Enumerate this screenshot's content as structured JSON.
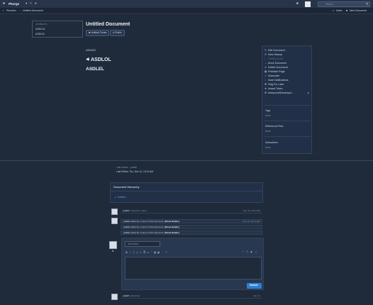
{
  "topbar": {
    "app_name": "Phorge",
    "notifications_count": "",
    "search_placeholder": "Search",
    "user_initial": ""
  },
  "crumbs": {
    "root": "Phriction",
    "current": "Untitled Document",
    "actions": [
      "Index",
      "New Document"
    ]
  },
  "toc": {
    "heading": "CONTENTS",
    "items": [
      "ASDLOL",
      "ASDLEL"
    ]
  },
  "header": {
    "title": "Untitled Document",
    "tags": [
      "Untitled Tortes",
      "Public"
    ]
  },
  "document": {
    "small_text": "ASDASD",
    "heading1": "ASDLOL",
    "heading2": "ASDLEL"
  },
  "actions": {
    "items": [
      {
        "label": "Edit Document",
        "icon": "pencil-icon",
        "enabled": true
      },
      {
        "label": "View History",
        "icon": "history-icon",
        "enabled": true
      },
      {
        "label": "Publish Draft",
        "icon": "upload-icon",
        "enabled": false
      },
      {
        "label": "Move Document",
        "icon": "arrows-icon",
        "enabled": true
      },
      {
        "label": "Delete Document",
        "icon": "x-icon",
        "enabled": true
      },
      {
        "label": "Printable Page",
        "icon": "print-icon",
        "enabled": true
      },
      {
        "label": "Subscribe",
        "icon": "check-icon",
        "enabled": true
      },
      {
        "label": "Mute Notifications",
        "icon": "mute-icon",
        "enabled": true
      },
      {
        "label": "Flag For Later",
        "icon": "flag-icon",
        "enabled": true
      },
      {
        "label": "Award Token",
        "icon": "trophy-icon",
        "enabled": true
      },
      {
        "label": "Advanced/Developer...",
        "icon": "wrench-icon",
        "enabled": true
      }
    ],
    "tags_label": "Tags",
    "tags_value": "None",
    "files_label": "Referenced Files",
    "files_value": "None",
    "subscribers_label": "Subscribers",
    "subscribers_value": "None"
  },
  "meta": {
    "last_author_label": "Last Author:",
    "last_author": "yodidi",
    "last_edited": "Last Edited: Thu, Dec 12, 10:14 AM"
  },
  "hierarchy": {
    "title": "Document Hierarchy",
    "item": "Subtree"
  },
  "feed": [
    {
      "author": "yodidi",
      "text": "created this object.",
      "link": "",
      "date": "Dec 12, 10:14 AM"
    },
    {
      "author": "yodidi",
      "text": "edited the content of this document.",
      "link": "(Show Details)",
      "date": "Dec 12, 10:14 AM"
    },
    {
      "author": "yodidi",
      "text": "edited the content of this document.",
      "link": "(Show Details)",
      "date": ""
    },
    {
      "author": "yodidi",
      "text": "edited the content of this document.",
      "link": "(Show Details)",
      "date": ""
    }
  ],
  "comment": {
    "action_placeholder": "Add Action...",
    "submit_label": "Submit"
  },
  "last_feed": {
    "author": "yodidi",
    "text": "subscribed.",
    "date": "Dec 12"
  },
  "colors": {
    "background": "#1f2a3a",
    "accent": "#2d7fd1",
    "link": "#5fa8e6"
  }
}
